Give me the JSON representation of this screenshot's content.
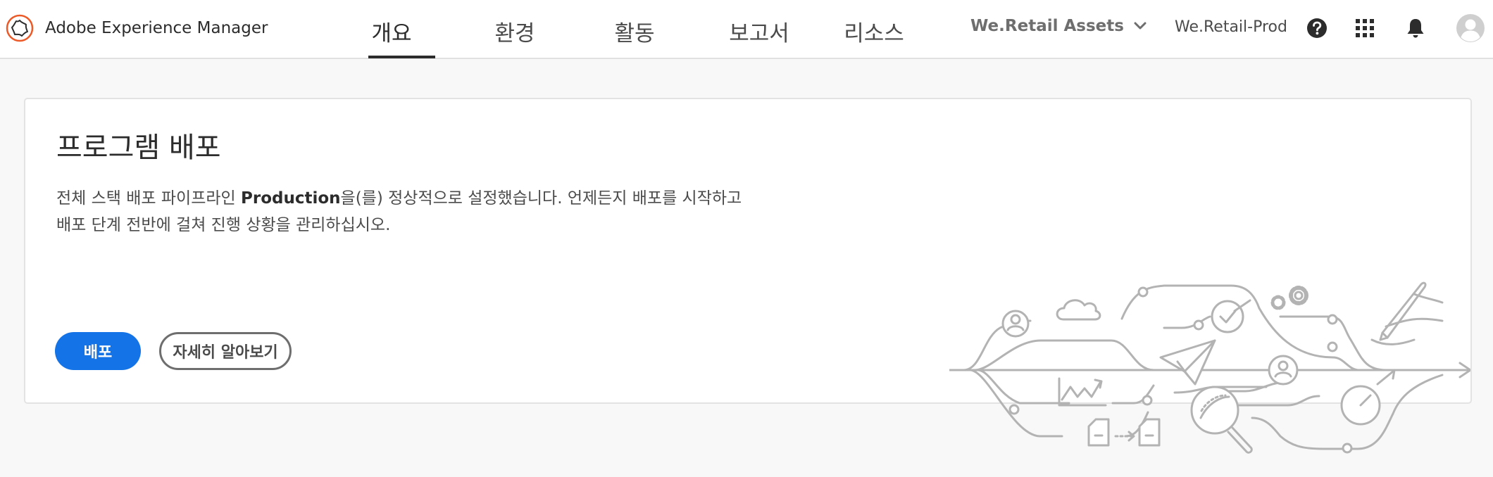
{
  "header": {
    "app_name": "Adobe Experience Manager",
    "tabs": [
      {
        "label": "개요",
        "active": true
      },
      {
        "label": "환경",
        "active": false
      },
      {
        "label": "활동",
        "active": false
      },
      {
        "label": "보고서",
        "active": false
      },
      {
        "label": "리소스",
        "active": false
      }
    ],
    "program_selector": "We.Retail Assets",
    "environment_name": "We.Retail-Prod",
    "icons": [
      "help-icon",
      "app-switcher-icon",
      "notifications-icon",
      "avatar"
    ]
  },
  "card": {
    "title": "프로그램 배포",
    "description_before": "전체 스택 배포 파이프라인 ",
    "pipeline_name": "Production",
    "description_after": "을(를) 정상적으로 설정했습니다. 언제든지 배포를 시작하고 배포 단계 전반에 걸쳐 진행 상황을 관리하십시오.",
    "primary_button": "배포",
    "secondary_button": "자세히 알아보기"
  },
  "colors": {
    "accent": "#1473e6",
    "logo_ring": "#eb5a28",
    "illustration_stroke": "#b3b3b3"
  }
}
